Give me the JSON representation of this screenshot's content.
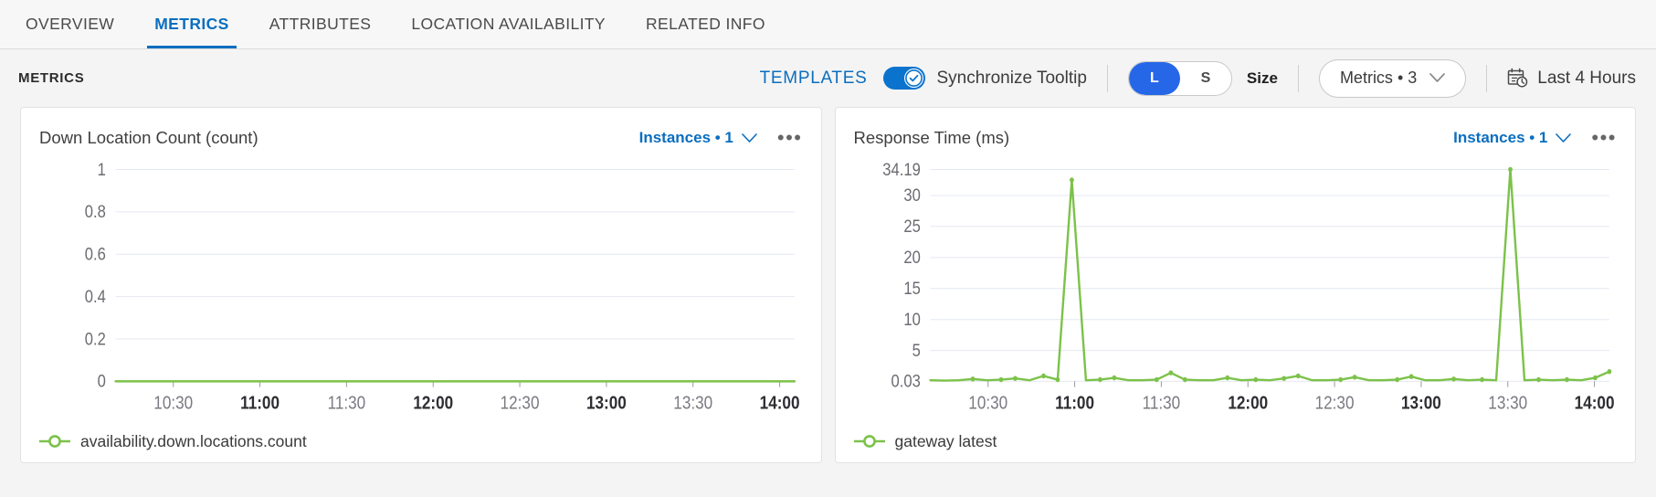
{
  "colors": {
    "accent_blue": "#0b6ebf",
    "toggle_blue": "#0a73cd",
    "segment_blue": "#2667e8",
    "series_green": "#7cc24a",
    "grid": "#e4e8f0",
    "page_bg": "#f4f4f4"
  },
  "tabs": [
    {
      "label": "OVERVIEW",
      "active": false
    },
    {
      "label": "METRICS",
      "active": true
    },
    {
      "label": "ATTRIBUTES",
      "active": false
    },
    {
      "label": "LOCATION AVAILABILITY",
      "active": false
    },
    {
      "label": "RELATED INFO",
      "active": false
    }
  ],
  "toolbar": {
    "title": "METRICS",
    "templates_label": "TEMPLATES",
    "sync_tooltip_label": "Synchronize Tooltip",
    "sync_tooltip_on": true,
    "size_options": [
      "L",
      "S"
    ],
    "size_selected": "L",
    "size_label": "Size",
    "metrics_dropdown": "Metrics • 3",
    "time_range": "Last 4 Hours",
    "icons": {
      "toggle_check": "check-icon",
      "dropdown": "chevron-down-icon",
      "calendar": "calendar-clock-icon"
    }
  },
  "cards": [
    {
      "title": "Down Location Count (count)",
      "instances_label": "Instances • 1",
      "menu_label": "•••",
      "legend_label": "availability.down.locations.count"
    },
    {
      "title": "Response Time (ms)",
      "instances_label": "Instances • 1",
      "menu_label": "•••",
      "legend_label": "gateway latest"
    }
  ],
  "chart_data": [
    {
      "type": "line",
      "title": "Down Location Count (count)",
      "xlabel": "",
      "ylabel": "count",
      "ylim": [
        0,
        1
      ],
      "yticks": [
        1,
        0.8,
        0.6,
        0.4,
        0.2,
        0
      ],
      "ytick_labels": [
        "1",
        "0.8",
        "0.6",
        "0.4",
        "0.2",
        "0"
      ],
      "xticks": [
        "10:30",
        "11:00",
        "11:30",
        "12:00",
        "12:30",
        "13:00",
        "13:30",
        "14:00"
      ],
      "xtick_bold": [
        false,
        true,
        false,
        true,
        false,
        true,
        false,
        true
      ],
      "grid": true,
      "legend_position": "bottom-left",
      "series": [
        {
          "name": "availability.down.locations.count",
          "color": "#7cc24a",
          "values": [
            0,
            0,
            0,
            0,
            0,
            0,
            0,
            0,
            0,
            0,
            0,
            0,
            0,
            0,
            0,
            0,
            0,
            0,
            0,
            0,
            0,
            0,
            0,
            0,
            0,
            0,
            0,
            0,
            0,
            0,
            0,
            0,
            0,
            0,
            0,
            0,
            0,
            0,
            0,
            0,
            0,
            0,
            0,
            0,
            0,
            0,
            0,
            0,
            0
          ]
        }
      ]
    },
    {
      "type": "line",
      "title": "Response Time (ms)",
      "xlabel": "",
      "ylabel": "ms",
      "ylim": [
        0.03,
        34.19
      ],
      "yticks": [
        34.19,
        30,
        25,
        20,
        15,
        10,
        5,
        0.03
      ],
      "ytick_labels": [
        "34.19",
        "30",
        "25",
        "20",
        "15",
        "10",
        "5",
        "0.03"
      ],
      "xticks": [
        "10:30",
        "11:00",
        "11:30",
        "12:00",
        "12:30",
        "13:00",
        "13:30",
        "14:00"
      ],
      "xtick_bold": [
        false,
        true,
        false,
        true,
        false,
        true,
        false,
        true
      ],
      "grid": true,
      "legend_position": "bottom-left",
      "series": [
        {
          "name": "gateway latest",
          "color": "#7cc24a",
          "values": [
            0.2,
            0.15,
            0.2,
            0.4,
            0.2,
            0.3,
            0.5,
            0.2,
            0.9,
            0.3,
            32.5,
            0.2,
            0.3,
            0.6,
            0.2,
            0.2,
            0.3,
            1.4,
            0.3,
            0.2,
            0.2,
            0.6,
            0.2,
            0.3,
            0.2,
            0.5,
            0.9,
            0.2,
            0.2,
            0.3,
            0.7,
            0.2,
            0.2,
            0.3,
            0.8,
            0.2,
            0.2,
            0.4,
            0.2,
            0.3,
            0.2,
            34.19,
            0.2,
            0.3,
            0.2,
            0.3,
            0.2,
            0.6,
            1.6
          ]
        }
      ]
    }
  ]
}
